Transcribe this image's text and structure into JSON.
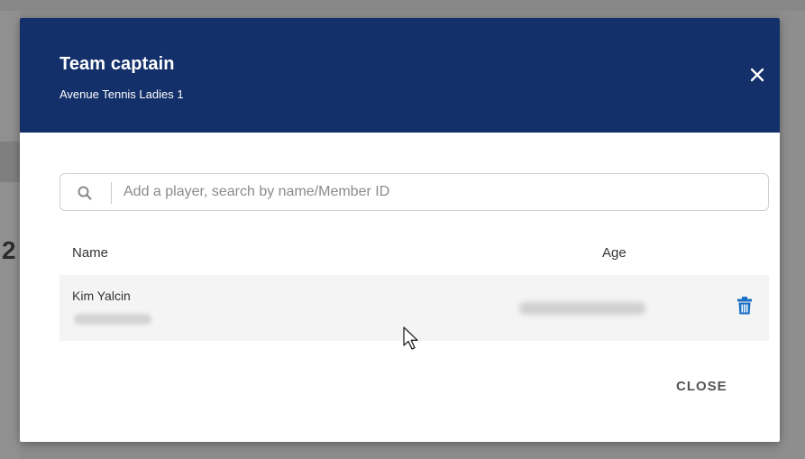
{
  "dialog": {
    "title": "Team captain",
    "subtitle": "Avenue Tennis Ladies 1",
    "close_icon": "close-icon"
  },
  "search": {
    "placeholder": "Add a player, search by name/Member ID",
    "icon": "search-icon"
  },
  "table": {
    "headers": {
      "name": "Name",
      "age": "Age"
    },
    "rows": [
      {
        "name": "Kim Yalcin",
        "delete_icon": "trash-icon"
      }
    ]
  },
  "footer": {
    "close_label": "CLOSE"
  },
  "colors": {
    "header_bg": "#13306a",
    "accent_blue": "#1a6fc4",
    "row_bg": "#f4f4f4",
    "backdrop": "#8c8c8c"
  }
}
